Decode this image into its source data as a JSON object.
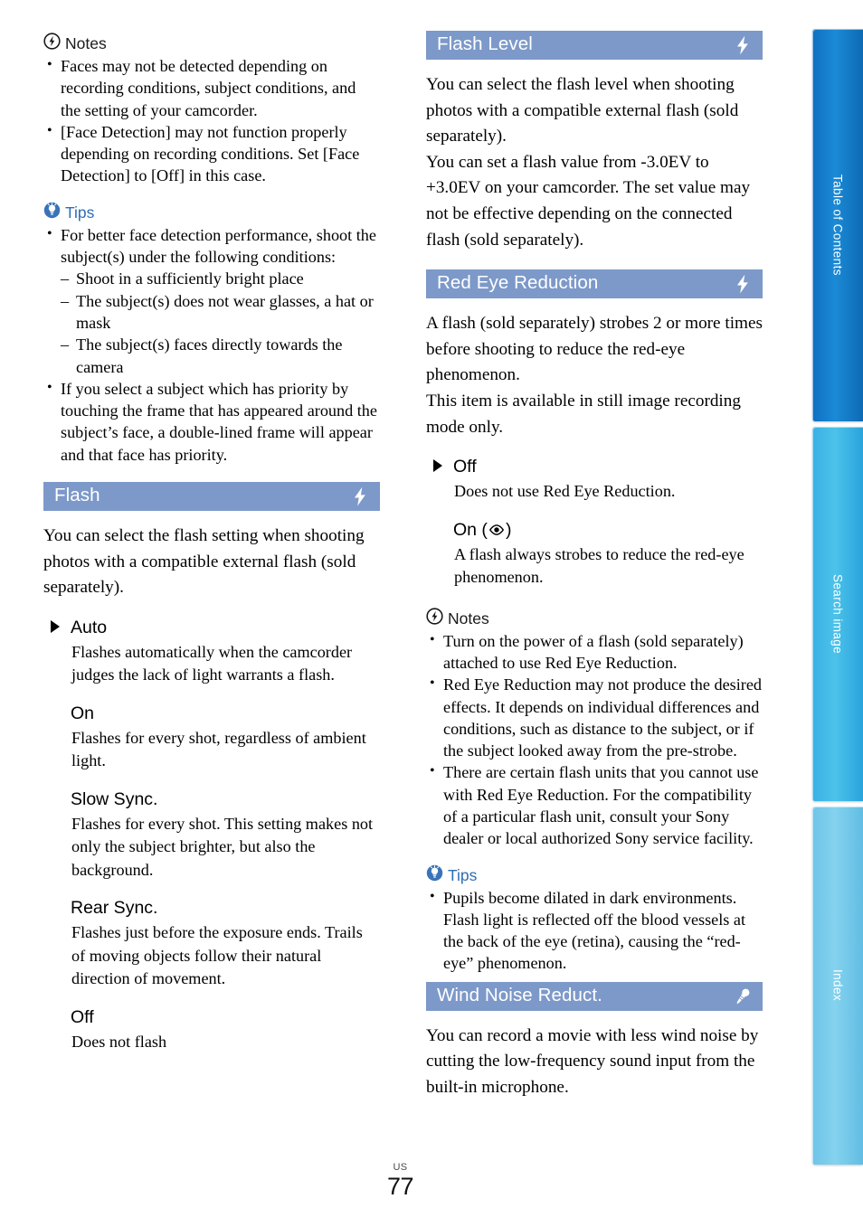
{
  "colors": {
    "header_bar": "#7d99c9",
    "tips_text": "#2f6db5",
    "tab_toc": "#1380cc",
    "tab_search": "#45bce8",
    "tab_index": "#7bcdec"
  },
  "left_column": {
    "notes_1": {
      "label": "Notes",
      "icon": "flash-circle-icon",
      "items": [
        "Faces may not be detected depending on recording conditions, subject conditions, and the setting of your camcorder.",
        "[Face Detection] may not function properly depending on recording conditions. Set [Face Detection] to [Off] in this case."
      ]
    },
    "tips_1": {
      "label": "Tips",
      "icon": "lightbulb-circle-icon",
      "item_1_lead": "For better face detection performance, shoot the subject(s) under the following conditions:",
      "item_1_sub": [
        "Shoot in a sufficiently bright place",
        "The subject(s) does not wear glasses, a hat or mask",
        "The subject(s) faces directly towards the camera"
      ],
      "item_2": "If you select a subject which has priority by touching the frame that has appeared around the subject’s face, a double-lined frame will appear and that face has priority."
    },
    "flash_section": {
      "title": "Flash",
      "icon": "flash-bolt-icon",
      "intro": "You can select the flash setting when shooting photos with a compatible external flash (sold separately).",
      "options": [
        {
          "name": "Auto",
          "default": true,
          "desc": "Flashes automatically when the camcorder judges the lack of light warrants a flash."
        },
        {
          "name": "On",
          "default": false,
          "desc": "Flashes for every shot, regardless of ambient light."
        },
        {
          "name": "Slow Sync.",
          "default": false,
          "desc": "Flashes for every shot. This setting makes not only the subject brighter, but also the background."
        },
        {
          "name": "Rear Sync.",
          "default": false,
          "desc": "Flashes just before the exposure ends. Trails of moving objects follow their natural direction of movement."
        },
        {
          "name": "Off",
          "default": false,
          "desc": "Does not flash"
        }
      ]
    }
  },
  "right_column": {
    "flash_level_section": {
      "title": "Flash Level",
      "icon": "flash-bolt-icon",
      "paragraphs": [
        "You can select the flash level when shooting photos with a compatible external flash (sold separately).",
        "You can set a flash value from -3.0EV to +3.0EV on your camcorder. The set value may not be effective depending on the connected flash (sold separately)."
      ]
    },
    "red_eye_section": {
      "title": "Red Eye Reduction",
      "icon": "flash-bolt-icon",
      "paragraphs": [
        "A flash (sold separately) strobes 2 or more times before shooting to reduce the red-eye phenomenon.",
        "This item is available in still image recording mode only."
      ],
      "options": [
        {
          "name": "Off",
          "default": true,
          "desc": "Does not use Red Eye Reduction."
        },
        {
          "name": "On (",
          "name_suffix": ")",
          "icon": "eye-icon",
          "default": false,
          "desc": "A flash always strobes to reduce the red-eye phenomenon."
        }
      ]
    },
    "notes_2": {
      "label": "Notes",
      "icon": "flash-circle-icon",
      "items": [
        "Turn on the power of a flash (sold separately) attached to use Red Eye Reduction.",
        "Red Eye Reduction may not produce the desired effects. It depends on individual differences and conditions, such as distance to the subject, or if the subject looked away from the pre-strobe.",
        "There are certain flash units that you cannot use with Red Eye Reduction. For the compatibility of a particular flash unit, consult your Sony dealer or local authorized Sony service facility."
      ]
    },
    "tips_2": {
      "label": "Tips",
      "icon": "lightbulb-circle-icon",
      "items": [
        "Pupils become dilated in dark environments. Flash light is reflected off the blood vessels at the back of the eye (retina), causing the “red-eye” phenomenon."
      ]
    },
    "wind_noise_section": {
      "title": "Wind Noise Reduct.",
      "icon": "microphone-icon",
      "intro": "You can record a movie with less wind noise by cutting the low-frequency sound input from the built-in microphone."
    }
  },
  "sidebar": {
    "tabs": [
      {
        "label": "Table of Contents"
      },
      {
        "label": "Search image"
      },
      {
        "label": "Index"
      }
    ]
  },
  "footer": {
    "region": "US",
    "page_number": "77"
  }
}
